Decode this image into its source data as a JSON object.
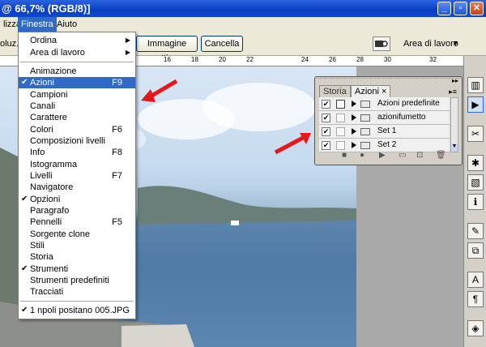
{
  "window": {
    "title": "@ 66,7% (RGB/8)]",
    "buttons": {
      "minimize": "_",
      "restore": "▫",
      "close": "✕"
    }
  },
  "menubar": {
    "items": [
      "lizza",
      "Finestra",
      "Aiuto"
    ]
  },
  "options": {
    "left_label": "oluz.:",
    "active_image_button": "Immagine attiva",
    "cancel_button": "Cancella",
    "workspace_label": "Area di lavoro"
  },
  "ruler": {
    "labels": [
      "16",
      "18",
      "20",
      "22",
      "24",
      "26",
      "28",
      "30",
      "32"
    ]
  },
  "finestra_menu": {
    "group1": [
      {
        "label": "Ordina",
        "submenu": true
      },
      {
        "label": "Area di lavoro",
        "submenu": true
      }
    ],
    "group2": [
      {
        "label": "Animazione",
        "checked": false,
        "shortcut": ""
      },
      {
        "label": "Azioni",
        "checked": true,
        "shortcut": "F9",
        "selected": true
      },
      {
        "label": "Campioni",
        "checked": false,
        "shortcut": ""
      },
      {
        "label": "Canali",
        "checked": false,
        "shortcut": ""
      },
      {
        "label": "Carattere",
        "checked": false,
        "shortcut": ""
      },
      {
        "label": "Colori",
        "checked": false,
        "shortcut": "F6"
      },
      {
        "label": "Composizioni livelli",
        "checked": false,
        "shortcut": ""
      },
      {
        "label": "Info",
        "checked": false,
        "shortcut": "F8"
      },
      {
        "label": "Istogramma",
        "checked": false,
        "shortcut": ""
      },
      {
        "label": "Livelli",
        "checked": false,
        "shortcut": "F7"
      },
      {
        "label": "Navigatore",
        "checked": false,
        "shortcut": ""
      },
      {
        "label": "Opzioni",
        "checked": true,
        "shortcut": ""
      },
      {
        "label": "Paragrafo",
        "checked": false,
        "shortcut": ""
      },
      {
        "label": "Pennelli",
        "checked": false,
        "shortcut": "F5"
      },
      {
        "label": "Sorgente clone",
        "checked": false,
        "shortcut": ""
      },
      {
        "label": "Stili",
        "checked": false,
        "shortcut": ""
      },
      {
        "label": "Storia",
        "checked": false,
        "shortcut": ""
      },
      {
        "label": "Strumenti",
        "checked": true,
        "shortcut": ""
      },
      {
        "label": "Strumenti predefiniti",
        "checked": false,
        "shortcut": ""
      },
      {
        "label": "Tracciati",
        "checked": false,
        "shortcut": ""
      }
    ],
    "group3": [
      {
        "label": "1 npoli positano 005.JPG",
        "checked": true
      }
    ]
  },
  "actions_panel": {
    "tabs": [
      "Storia",
      "Azioni"
    ],
    "close_tab": "×",
    "rows": [
      "Azioni predefinite",
      "azionifumetto",
      "Set 1",
      "Set 2"
    ]
  },
  "colors": {
    "accent": "#316ac5",
    "annotation_arrow": "#e8151b",
    "title_bar": "#0a3fc4"
  }
}
